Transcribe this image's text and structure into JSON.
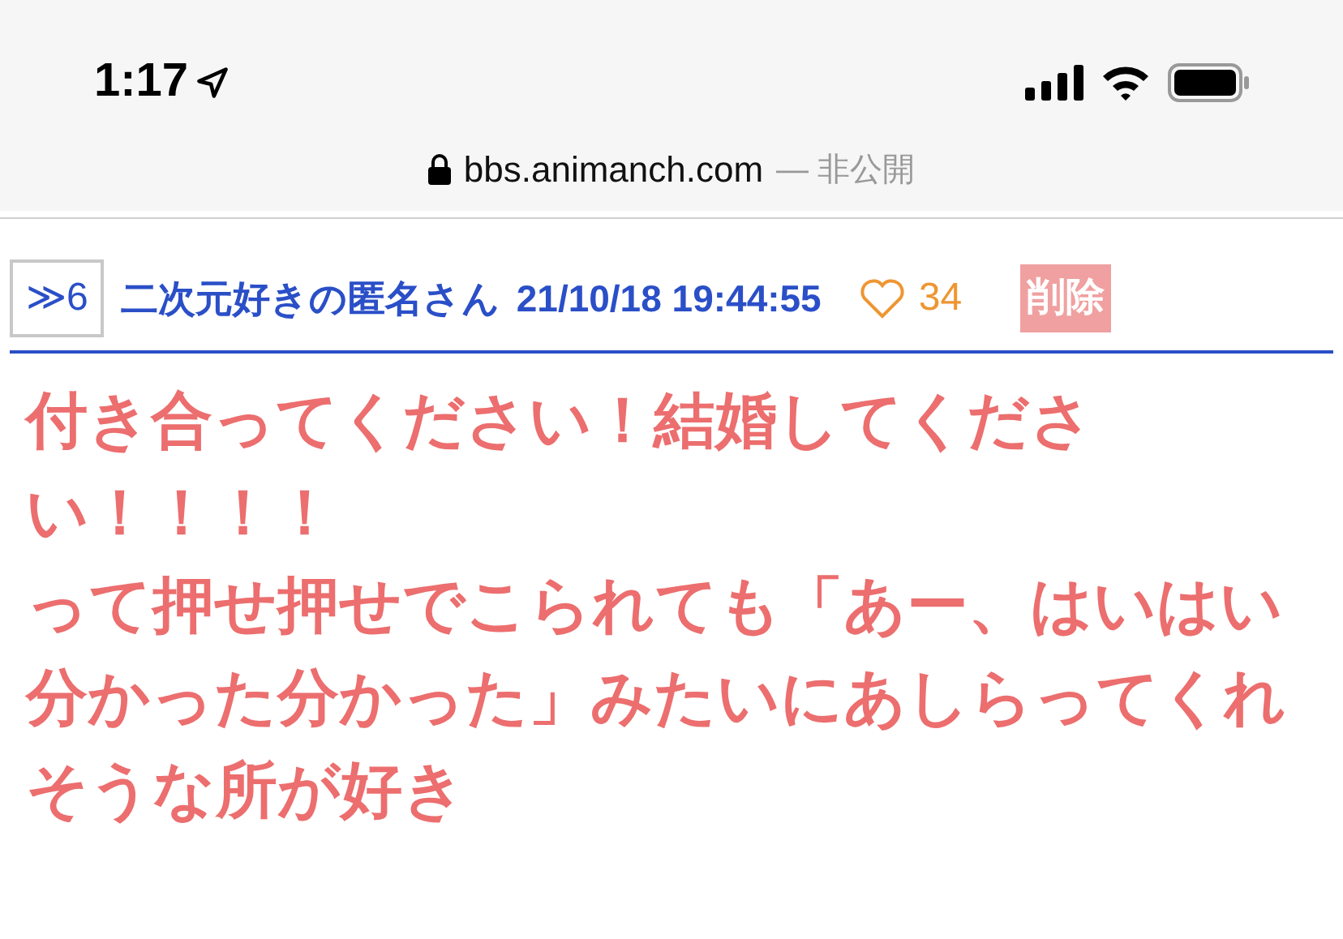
{
  "status_bar": {
    "time": "1:17"
  },
  "address_bar": {
    "domain": "bbs.animanch.com",
    "suffix": "— 非公開"
  },
  "post": {
    "number": "≫6",
    "author": "二次元好きの匿名さん",
    "timestamp": "21/10/18 19:44:55",
    "likes": "34",
    "liked": false,
    "delete_label": "削除",
    "paragraphs": [
      "付き合ってください！結婚してください！！！！",
      "って押せ押せでこられても「あー、はいはい分かった分かった」みたいにあしらってくれそうな所が好き"
    ]
  }
}
